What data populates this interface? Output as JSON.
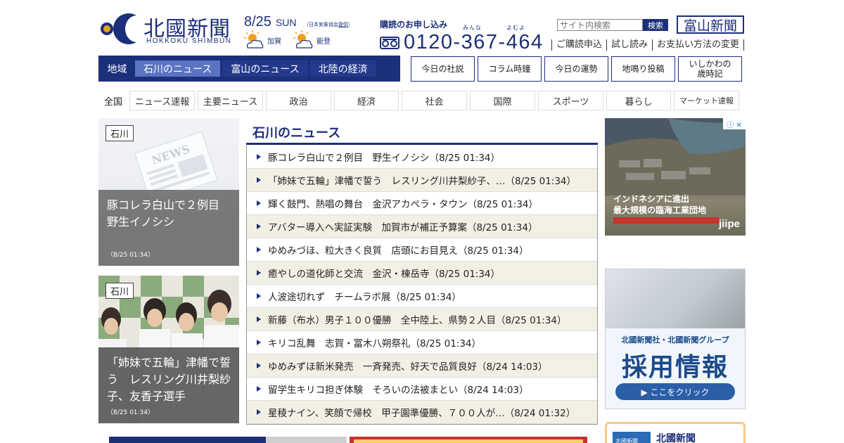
{
  "logo": {
    "name": "北國新聞",
    "romaji": "HOKKOKU SHIMBUN"
  },
  "date": {
    "md": "8/25",
    "dow": "SUN",
    "credit_prefix": "（日本気象協会",
    "credit_link": "提供",
    "credit_suffix": "）"
  },
  "weather": [
    {
      "place": "加賀",
      "icon": "sun-cloud-icon"
    },
    {
      "place": "能登",
      "icon": "sun-cloud-icon"
    }
  ],
  "subscribe": {
    "title": "購読のお申し込み",
    "ruby1": "みんな",
    "ruby2": "よむよ",
    "phone": "0120-367-464"
  },
  "search": {
    "placeholder": "サイト内検索",
    "button": "検索"
  },
  "toyama_button": "富山新聞",
  "top_links": [
    "ご購読申込",
    "試し読み",
    "お支払い方法の変更"
  ],
  "region_nav": {
    "label": "地域",
    "tabs": [
      "石川のニュース",
      "富山のニュース",
      "北陸の経済"
    ]
  },
  "feature_buttons": [
    "今日の社説",
    "コラム時鐘",
    "今日の運勢",
    "地鳴り投稿",
    "いしかわの\n歳時記"
  ],
  "categories": {
    "all": "全国",
    "items": [
      "ニュース速報",
      "主要ニュース",
      "政治",
      "経済",
      "社会",
      "国際",
      "スポーツ",
      "暮らし",
      "マーケット速報"
    ]
  },
  "cards": [
    {
      "badge": "石川",
      "title": "豚コレラ白山で２例目　野生イノシシ",
      "time": "（8/25 01:34）"
    },
    {
      "badge": "石川",
      "title": "「姉妹で五輪」津幡で誓う　レスリング川井梨紗子、友香子選手",
      "time": "（8/25 01:34）"
    }
  ],
  "news": {
    "heading": "石川のニュース",
    "items": [
      "豚コレラ白山で２例目　野生イノシシ（8/25 01:34）",
      "「姉妹で五輪」津幡で誓う　レスリング川井梨紗子、…（8/25 01:34）",
      "輝く鼓門、熱唱の舞台　金沢アカペラ・タウン（8/25 01:34）",
      "アバター導入へ実証実験　加賀市が補正予算案（8/25 01:34）",
      "ゆめみづほ、粒大きく良質　店頭にお目見え（8/25 01:34）",
      "癒やしの道化師と交流　金沢・棟岳寺（8/25 01:34）",
      "人波途切れず　チームラボ展（8/25 01:34）",
      "新藤（布水）男子１００優勝　全中陸上、県勢２人目（8/25 01:34）",
      "キリコ乱舞　志賀・冨木八朔祭礼（8/25 01:34）",
      "ゆめみずほ新米発売　一斉発売、好天で品質良好（8/24 14:03）",
      "留学生キリコ担ぎ体験　そろいの法被まとい（8/24 14:03）",
      "星稜ナイン、笑顔で帰校　甲子園準優勝、７００人が…（8/24 01:32）"
    ]
  },
  "ads": {
    "ad1": {
      "line1": "インドネシアに進出",
      "line2": "最大規模の臨海工業団地",
      "brand": "jiipe"
    },
    "ad2": {
      "sub": "北國新聞社・北國新聞グループ",
      "main": "採用情報",
      "cta": "▶ ここをクリック"
    },
    "ad3": {
      "box": "北國新聞",
      "text": "北國新聞"
    }
  }
}
